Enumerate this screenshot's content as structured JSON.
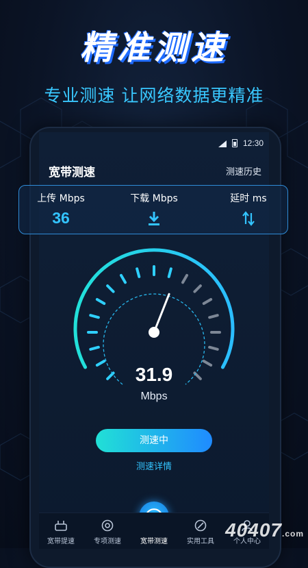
{
  "promo": {
    "headline": "精准测速",
    "subline": "专业测速 让网络数据更精准"
  },
  "status_bar": {
    "time": "12:30"
  },
  "header": {
    "title": "宽带测速",
    "history_label": "测速历史"
  },
  "stats": {
    "upload": {
      "label": "上传 Mbps",
      "value": "36"
    },
    "download": {
      "label": "下载 Mbps",
      "icon": "download-arrow-icon"
    },
    "latency": {
      "label": "延时 ms",
      "icon": "swap-vertical-icon"
    }
  },
  "gauge": {
    "speed": "31.9",
    "unit": "Mbps",
    "level_fraction": 0.58
  },
  "actions": {
    "test_button_label": "测速中",
    "details_label": "测速详情"
  },
  "tabs": [
    {
      "label": "宽带提速",
      "icon": "router-icon"
    },
    {
      "label": "专项测速",
      "icon": "target-icon"
    },
    {
      "label": "宽带测速",
      "icon": "speedometer-icon",
      "active": true
    },
    {
      "label": "实用工具",
      "icon": "tools-icon"
    },
    {
      "label": "个人中心",
      "icon": "user-icon"
    }
  ],
  "watermark": {
    "text": "40407",
    "suffix": ".com"
  },
  "colors": {
    "accent": "#33c4ff",
    "button_start": "#21e0d6",
    "button_end": "#1f8bff",
    "background": "#0b1426"
  }
}
